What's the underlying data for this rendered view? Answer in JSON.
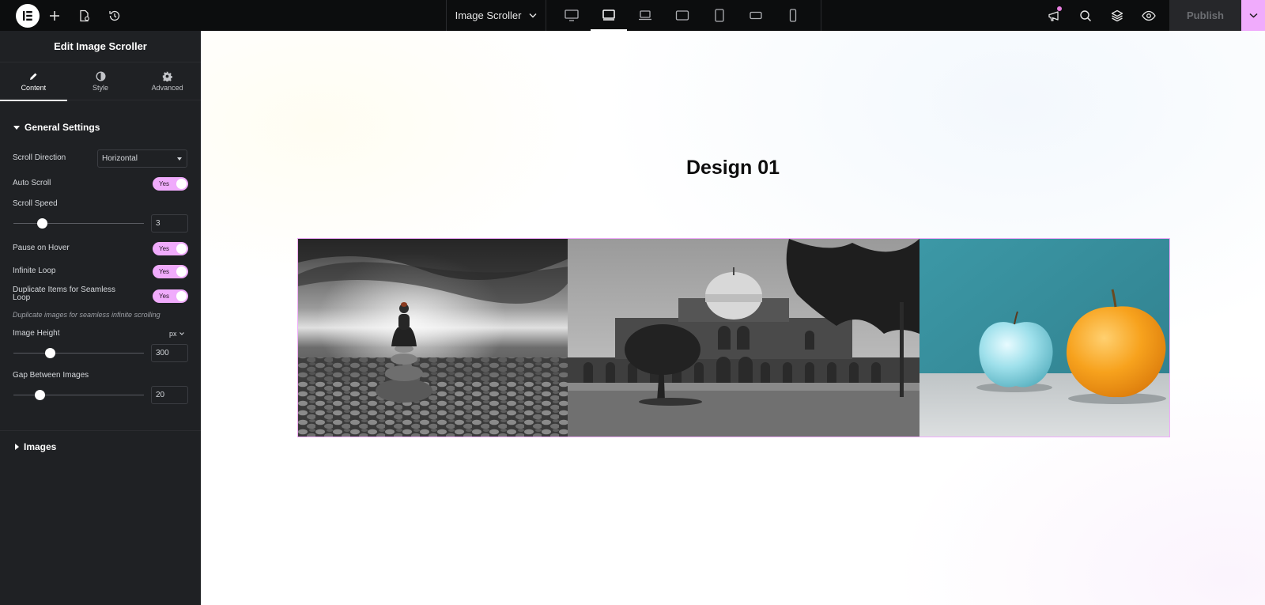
{
  "topbar": {
    "document_title": "Image Scroller",
    "publish_label": "Publish",
    "left_icons": [
      "elementor-logo-icon",
      "plus-icon",
      "page-settings-icon",
      "history-icon"
    ],
    "device_icons": [
      "desktop-icon",
      "widescreen-icon",
      "laptop-icon",
      "tablet-landscape-icon",
      "tablet-portrait-icon",
      "mobile-landscape-icon",
      "mobile-portrait-icon"
    ],
    "right_icons": [
      "whats-new-icon",
      "search-icon",
      "structure-icon",
      "preview-icon"
    ]
  },
  "panel": {
    "title": "Edit Image Scroller",
    "tabs": [
      {
        "label": "Content",
        "icon": "pencil-icon"
      },
      {
        "label": "Style",
        "icon": "contrast-icon"
      },
      {
        "label": "Advanced",
        "icon": "gear-icon"
      }
    ],
    "general_section": "General Settings",
    "scroll_direction": {
      "label": "Scroll Direction",
      "value": "Horizontal"
    },
    "auto_scroll": {
      "label": "Auto Scroll",
      "value": "Yes"
    },
    "scroll_speed": {
      "label": "Scroll Speed",
      "value": "3",
      "min": 0,
      "max": 10,
      "fraction": 0.22
    },
    "pause_on_hover": {
      "label": "Pause on Hover",
      "value": "Yes"
    },
    "infinite_loop": {
      "label": "Infinite Loop",
      "value": "Yes"
    },
    "duplicate_items": {
      "label_line1": "Duplicate Items for Seamless",
      "label_line2": "Loop",
      "value": "Yes",
      "hint": "Duplicate images for seamless infinite scrolling"
    },
    "image_height": {
      "label": "Image Height",
      "unit": "px",
      "value": "300",
      "fraction": 0.28
    },
    "gap": {
      "label": "Gap Between Images",
      "value": "20",
      "fraction": 0.2
    },
    "images_section": "Images"
  },
  "canvas": {
    "heading": "Design 01",
    "images": [
      {
        "name": "zen-stones-photo",
        "description": "Black and white meditating figure on stacked stones by the sea"
      },
      {
        "name": "humayun-tomb-photo",
        "description": "Black and white photo of a domed mausoleum with trees"
      },
      {
        "name": "apple-orange-photo",
        "description": "Blue apple and orange on teal background"
      }
    ]
  },
  "colors": {
    "accent": "#f0abfc",
    "panel_bg": "#1f2124",
    "topbar_bg": "#0c0d0e"
  }
}
